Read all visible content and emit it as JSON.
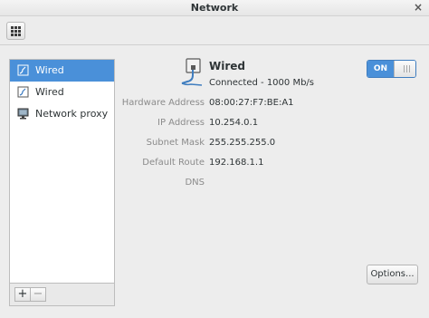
{
  "window": {
    "title": "Network",
    "close_glyph": "×"
  },
  "sidebar": {
    "items": [
      {
        "label": "Wired",
        "icon": "wired-icon"
      },
      {
        "label": "Wired",
        "icon": "wired-icon"
      },
      {
        "label": "Network proxy",
        "icon": "network-proxy-icon"
      }
    ],
    "add_label": "+",
    "remove_label": "−"
  },
  "connection": {
    "title": "Wired",
    "status": "Connected - 1000 Mb/s",
    "switch_label": "ON",
    "switch_state": "on"
  },
  "details": [
    {
      "label": "Hardware Address",
      "value": "08:00:27:F7:BE:A1"
    },
    {
      "label": "IP Address",
      "value": "10.254.0.1"
    },
    {
      "label": "Subnet Mask",
      "value": "255.255.255.0"
    },
    {
      "label": "Default Route",
      "value": "192.168.1.1"
    },
    {
      "label": "DNS",
      "value": ""
    }
  ],
  "options_label": "Options...",
  "colors": {
    "accent": "#4a90d9",
    "background": "#ededed"
  }
}
